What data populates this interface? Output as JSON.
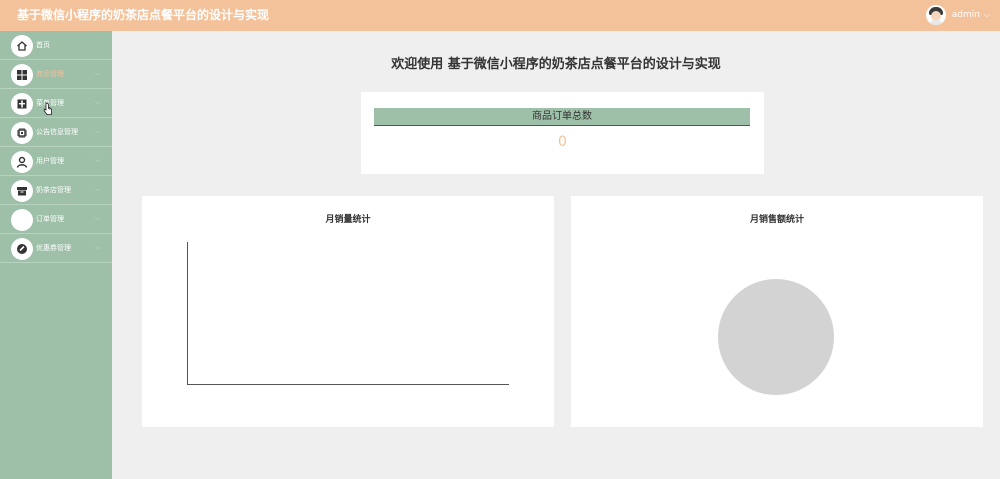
{
  "header": {
    "title": "基于微信小程序的奶茶店点餐平台的设计与实现",
    "username": "admin",
    "dropdown_glyph": "⌵"
  },
  "sidebar": {
    "items": [
      {
        "label": "首页",
        "icon": "home-icon",
        "active": false
      },
      {
        "label": "商品管理",
        "icon": "grid-icon",
        "active": true
      },
      {
        "label": "菜单管理",
        "icon": "menu-icon",
        "active": false
      },
      {
        "label": "公告信息管理",
        "icon": "chip-icon",
        "active": false
      },
      {
        "label": "用户管理",
        "icon": "user-icon",
        "active": false
      },
      {
        "label": "奶茶店管理",
        "icon": "store-icon",
        "active": false
      },
      {
        "label": "订单管理",
        "icon": "order-icon",
        "active": false
      },
      {
        "label": "优惠券管理",
        "icon": "coupon-icon",
        "active": false
      }
    ],
    "arrow_glyph": "⌵"
  },
  "main": {
    "welcome": "欢迎使用 基于微信小程序的奶茶店点餐平台的设计与实现",
    "order_total": {
      "label": "商品订单总数",
      "value": "0"
    }
  },
  "chart_data": [
    {
      "type": "line",
      "title": "月销量统计",
      "x": [],
      "series": [],
      "grid": false
    },
    {
      "type": "pie",
      "title": "月销售额统计",
      "slices": [],
      "empty_color": "#d3d3d3"
    }
  ],
  "colors": {
    "header_bg": "#f3c29b",
    "sidebar_bg": "#9ebfa8",
    "page_bg": "#efefef",
    "accent": "#f3c29b"
  }
}
